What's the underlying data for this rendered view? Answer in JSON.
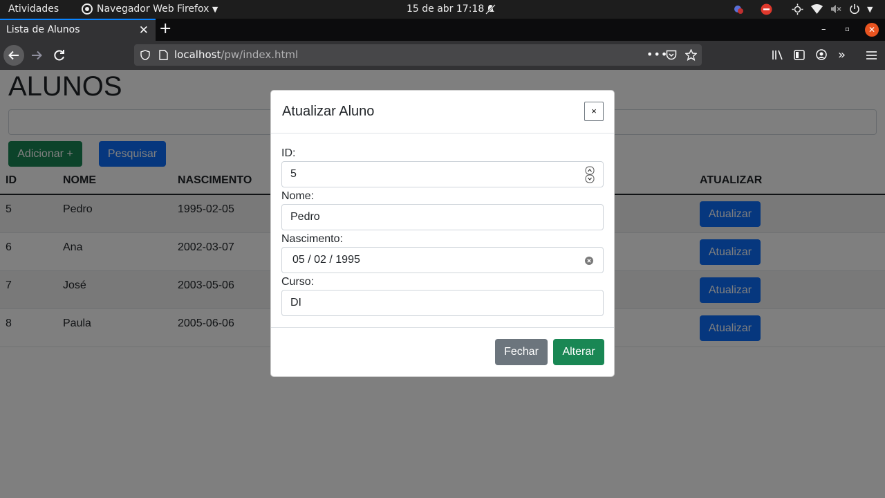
{
  "system_bar": {
    "activities": "Atividades",
    "app_name": "Navegador Web Firefox",
    "datetime": "15 de abr  17:18"
  },
  "browser": {
    "tab_title": "Lista de Alunos",
    "url_host": "localhost",
    "url_path": "/pw/index.html"
  },
  "page": {
    "title": "ALUNOS",
    "add_button": "Adicionar +",
    "search_button": "Pesquisar",
    "columns": {
      "id": "ID",
      "name": "NOME",
      "birth": "NASCIMENTO",
      "update": "ATUALIZAR"
    },
    "rows": [
      {
        "id": "5",
        "name": "Pedro",
        "birth": "1995-02-05",
        "action": "Atualizar"
      },
      {
        "id": "6",
        "name": "Ana",
        "birth": "2002-03-07",
        "action": "Atualizar"
      },
      {
        "id": "7",
        "name": "José",
        "birth": "2003-05-06",
        "action": "Atualizar"
      },
      {
        "id": "8",
        "name": "Paula",
        "birth": "2005-06-06",
        "action": "Atualizar"
      }
    ]
  },
  "modal": {
    "title": "Atualizar Aluno",
    "close_symbol": "×",
    "id_label": "ID:",
    "id_value": "5",
    "name_label": "Nome:",
    "name_value": "Pedro",
    "birth_label": "Nascimento:",
    "birth_value": "05 / 02 / 1995",
    "course_label": "Curso:",
    "course_value": "DI",
    "close_button": "Fechar",
    "save_button": "Alterar"
  },
  "colors": {
    "success": "#198754",
    "primary": "#0d6efd",
    "secondary": "#6c757d",
    "ubuntu_orange": "#e95420"
  }
}
